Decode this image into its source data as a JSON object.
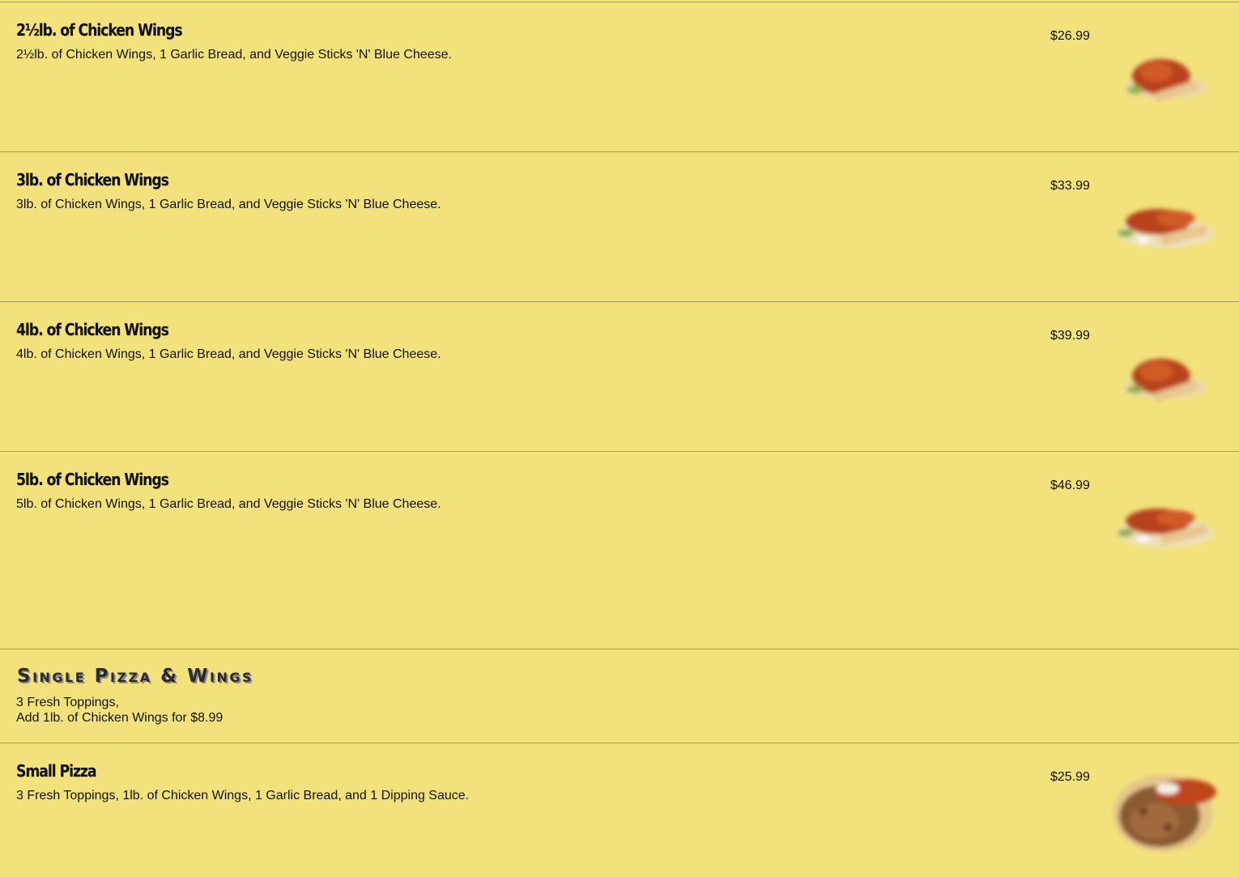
{
  "wings_items": [
    {
      "title": "2½lb. of Chicken Wings",
      "description": "2½lb. of Chicken Wings, 1 Garlic Bread, and Veggie Sticks 'N' Blue Cheese.",
      "price": "$26.99"
    },
    {
      "title": "3lb. of Chicken Wings",
      "description": "3lb. of Chicken Wings, 1 Garlic Bread, and Veggie Sticks 'N' Blue Cheese.",
      "price": "$33.99"
    },
    {
      "title": "4lb. of Chicken Wings",
      "description": "4lb. of Chicken Wings, 1 Garlic Bread, and Veggie Sticks 'N' Blue Cheese.",
      "price": "$39.99"
    },
    {
      "title": "5lb. of Chicken Wings",
      "description": "5lb. of Chicken Wings, 1 Garlic Bread, and Veggie Sticks 'N' Blue Cheese.",
      "price": "$46.99"
    }
  ],
  "section": {
    "title": "Single Pizza & Wings",
    "description_line1": "3 Fresh Toppings,",
    "description_line2": "Add 1lb. of Chicken Wings for $8.99"
  },
  "pizza_items": [
    {
      "title": "Small Pizza",
      "description": "3 Fresh Toppings, 1lb. of Chicken Wings, 1 Garlic Bread, and 1 Dipping Sauce.",
      "price": "$25.99"
    }
  ],
  "colors": {
    "background": "#f3e27b",
    "divider": "#a89e5c",
    "text": "#111111"
  }
}
